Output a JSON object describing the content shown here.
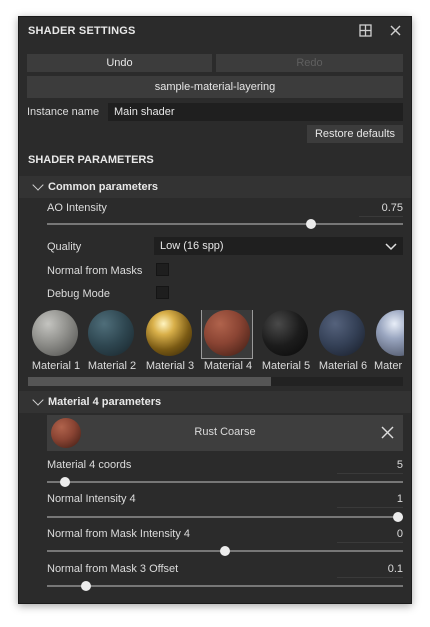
{
  "header": {
    "title": "SHADER SETTINGS",
    "dock_icon": "dock-icon",
    "close_icon": "close-icon"
  },
  "actions": {
    "undo": "Undo",
    "redo": "Redo",
    "material": "sample-material-layering",
    "restore": "Restore defaults"
  },
  "instance": {
    "label": "Instance name",
    "value": "Main shader"
  },
  "shader_parameters": {
    "title": "SHADER PARAMETERS"
  },
  "common": {
    "title": "Common parameters",
    "ao": {
      "label": "AO Intensity",
      "value": "0.75",
      "fraction": 0.75
    },
    "quality": {
      "label": "Quality",
      "value": "Low (16 spp)"
    },
    "normal_from_masks": {
      "label": "Normal from Masks",
      "checked": false
    },
    "debug_mode": {
      "label": "Debug Mode",
      "checked": false
    },
    "materials": [
      {
        "label": "Material 1",
        "color": "#9a9a96"
      },
      {
        "label": "Material 2",
        "color": "#2f4a55"
      },
      {
        "label": "Material 3",
        "color": "#c9a23a"
      },
      {
        "label": "Material 4",
        "color": "#8a4433",
        "selected": true
      },
      {
        "label": "Material 5",
        "color": "#1c1c1c"
      },
      {
        "label": "Material 6",
        "color": "#344056"
      },
      {
        "label": "Mater",
        "color": "#8a96b0"
      }
    ]
  },
  "material4": {
    "title": "Material 4 parameters",
    "name": "Rust Coarse",
    "coords": {
      "label": "Material 4 coords",
      "value": "5",
      "fraction": 0.05
    },
    "normal_intensity": {
      "label": "Normal Intensity 4",
      "value": "1",
      "fraction": 1.0
    },
    "mask_intensity": {
      "label": "Normal from Mask Intensity 4",
      "value": "0",
      "fraction": 0.5
    },
    "mask_offset": {
      "label": "Normal from Mask 3 Offset",
      "value": "0.1",
      "fraction": 0.11
    }
  },
  "colors": {
    "panel": "#2b2b2b",
    "button": "#3c3c3c",
    "field": "#1f1f1f"
  }
}
